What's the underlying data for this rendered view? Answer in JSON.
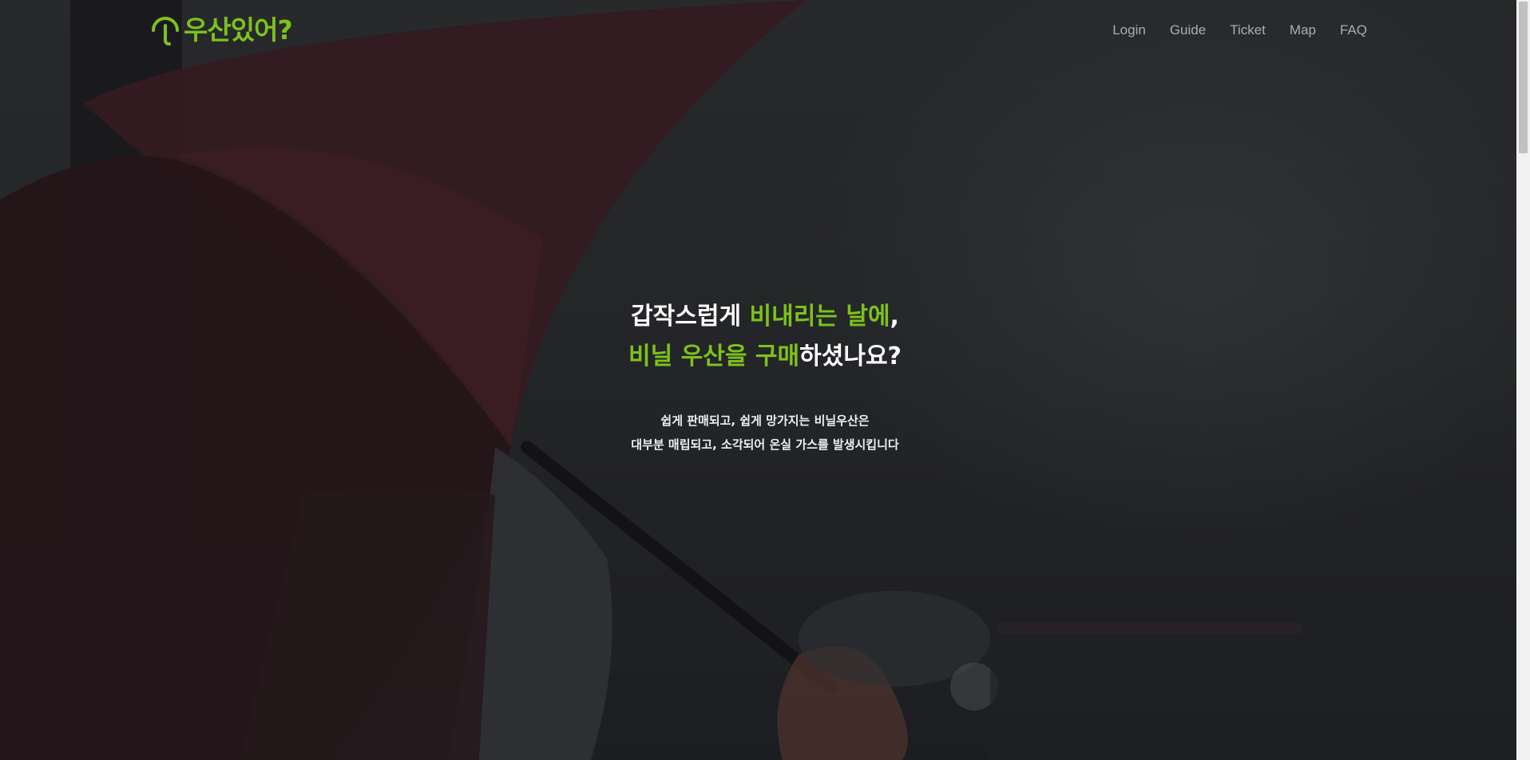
{
  "logo": {
    "text": "우산있어?",
    "icon": "umbrella-handle-icon",
    "color": "#7cc21c"
  },
  "nav": {
    "items": [
      {
        "label": "Login"
      },
      {
        "label": "Guide"
      },
      {
        "label": "Ticket"
      },
      {
        "label": "Map"
      },
      {
        "label": "FAQ"
      }
    ]
  },
  "hero": {
    "line1_white": "갑작스럽게 ",
    "line1_green": "비내리는 날에",
    "line1_end": ",",
    "line2_green": "비닐 우산을 구매",
    "line2_white": "하셨나요?",
    "desc_line1": "쉽게 판매되고, 쉽게 망가지는 비닐우산은",
    "desc_line2": "대부분 매립되고, 소각되어 온실 가스를 발생시킵니다"
  },
  "colors": {
    "accent": "#7cc21c",
    "text_light": "#ffffff",
    "nav_text": "#a9adb0"
  }
}
